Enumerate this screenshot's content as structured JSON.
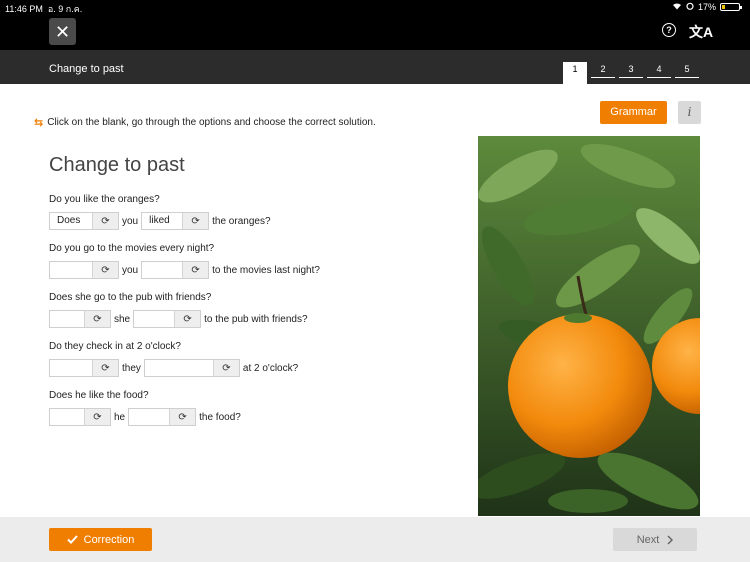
{
  "status": {
    "time": "11:46 PM",
    "date": "อ. 9 ก.ค.",
    "battery": "17%",
    "battery_level": 0.17
  },
  "header": {
    "close_icon": "✕",
    "help_icon": "?",
    "translate_icon": "文A"
  },
  "lesson": {
    "title": "Change to past",
    "pages": [
      "1",
      "2",
      "3",
      "4",
      "5"
    ],
    "active_page": "1"
  },
  "buttons": {
    "grammar": "Grammar",
    "info": "i",
    "correction": "Correction",
    "next": "Next"
  },
  "instruction": "Click on the blank, go through the options and choose the correct solution.",
  "exercise": {
    "title": "Change to past",
    "items": [
      {
        "question": "Do you like the oranges?",
        "blank1": "Does",
        "word1": "you",
        "blank2": "liked",
        "word2": "the oranges?"
      },
      {
        "question": "Do you go to the movies every night?",
        "blank1": "",
        "word1": "you",
        "blank2": "",
        "word2": "to the movies last night?"
      },
      {
        "question": "Does she go to the pub with friends?",
        "blank1": "",
        "word1": "she",
        "blank2": "",
        "word2": "to the pub with friends?"
      },
      {
        "question": "Do they check in at 2 o'clock?",
        "blank1": "",
        "word1": "they",
        "blank2": "",
        "word2": "at 2 o'clock?"
      },
      {
        "question": "Does he like the food?",
        "blank1": "",
        "word1": "he",
        "blank2": "",
        "word2": "the food?"
      }
    ]
  },
  "icons": {
    "cycle": "refresh-icon",
    "check": "check-icon",
    "chevron": "chevron-right-icon",
    "swap": "swap-arrows-icon"
  },
  "colors": {
    "accent": "#f07e00",
    "topbar": "#000000",
    "titlebar": "#2c2c2c"
  }
}
